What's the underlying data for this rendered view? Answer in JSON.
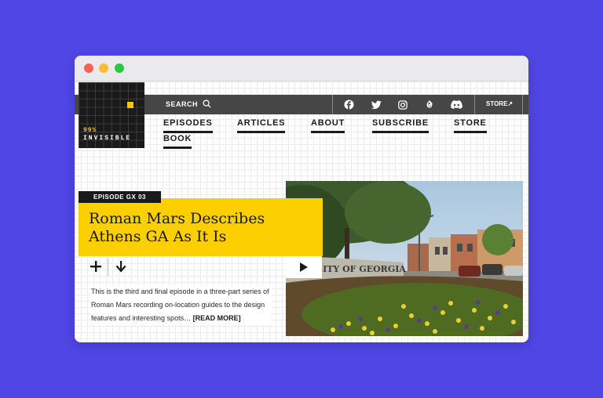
{
  "colors": {
    "background": "#4f46e5",
    "topbar": "#464646",
    "accent_yellow": "#fccf00",
    "logo_bg": "#1a1a1a"
  },
  "window": {
    "controls": [
      "close",
      "minimize",
      "zoom"
    ]
  },
  "logo": {
    "number": "99%",
    "word": "INVISIBLE"
  },
  "topbar": {
    "search_label": "SEARCH",
    "search_icon": "search-icon",
    "social_icons": [
      "facebook-icon",
      "twitter-icon",
      "instagram-icon",
      "threads-icon",
      "discord-icon"
    ],
    "store_label": "STORE↗"
  },
  "nav": {
    "items": [
      "EPISODES",
      "ARTICLES",
      "ABOUT",
      "SUBSCRIBE",
      "STORE",
      "BOOK"
    ]
  },
  "featured": {
    "episode_label": "EPISODE GX 03",
    "title": "Roman Mars Describes Athens GA As It Is",
    "description": "This is the third and final episode in a three-part series of Roman Mars recording on-location guides to the design features and interesting spots…",
    "read_more": "[READ MORE]",
    "image_sign_text": "RSITY OF GEORGIA",
    "actions": [
      "plus-icon",
      "download-icon"
    ],
    "play_icon": "play-icon"
  }
}
